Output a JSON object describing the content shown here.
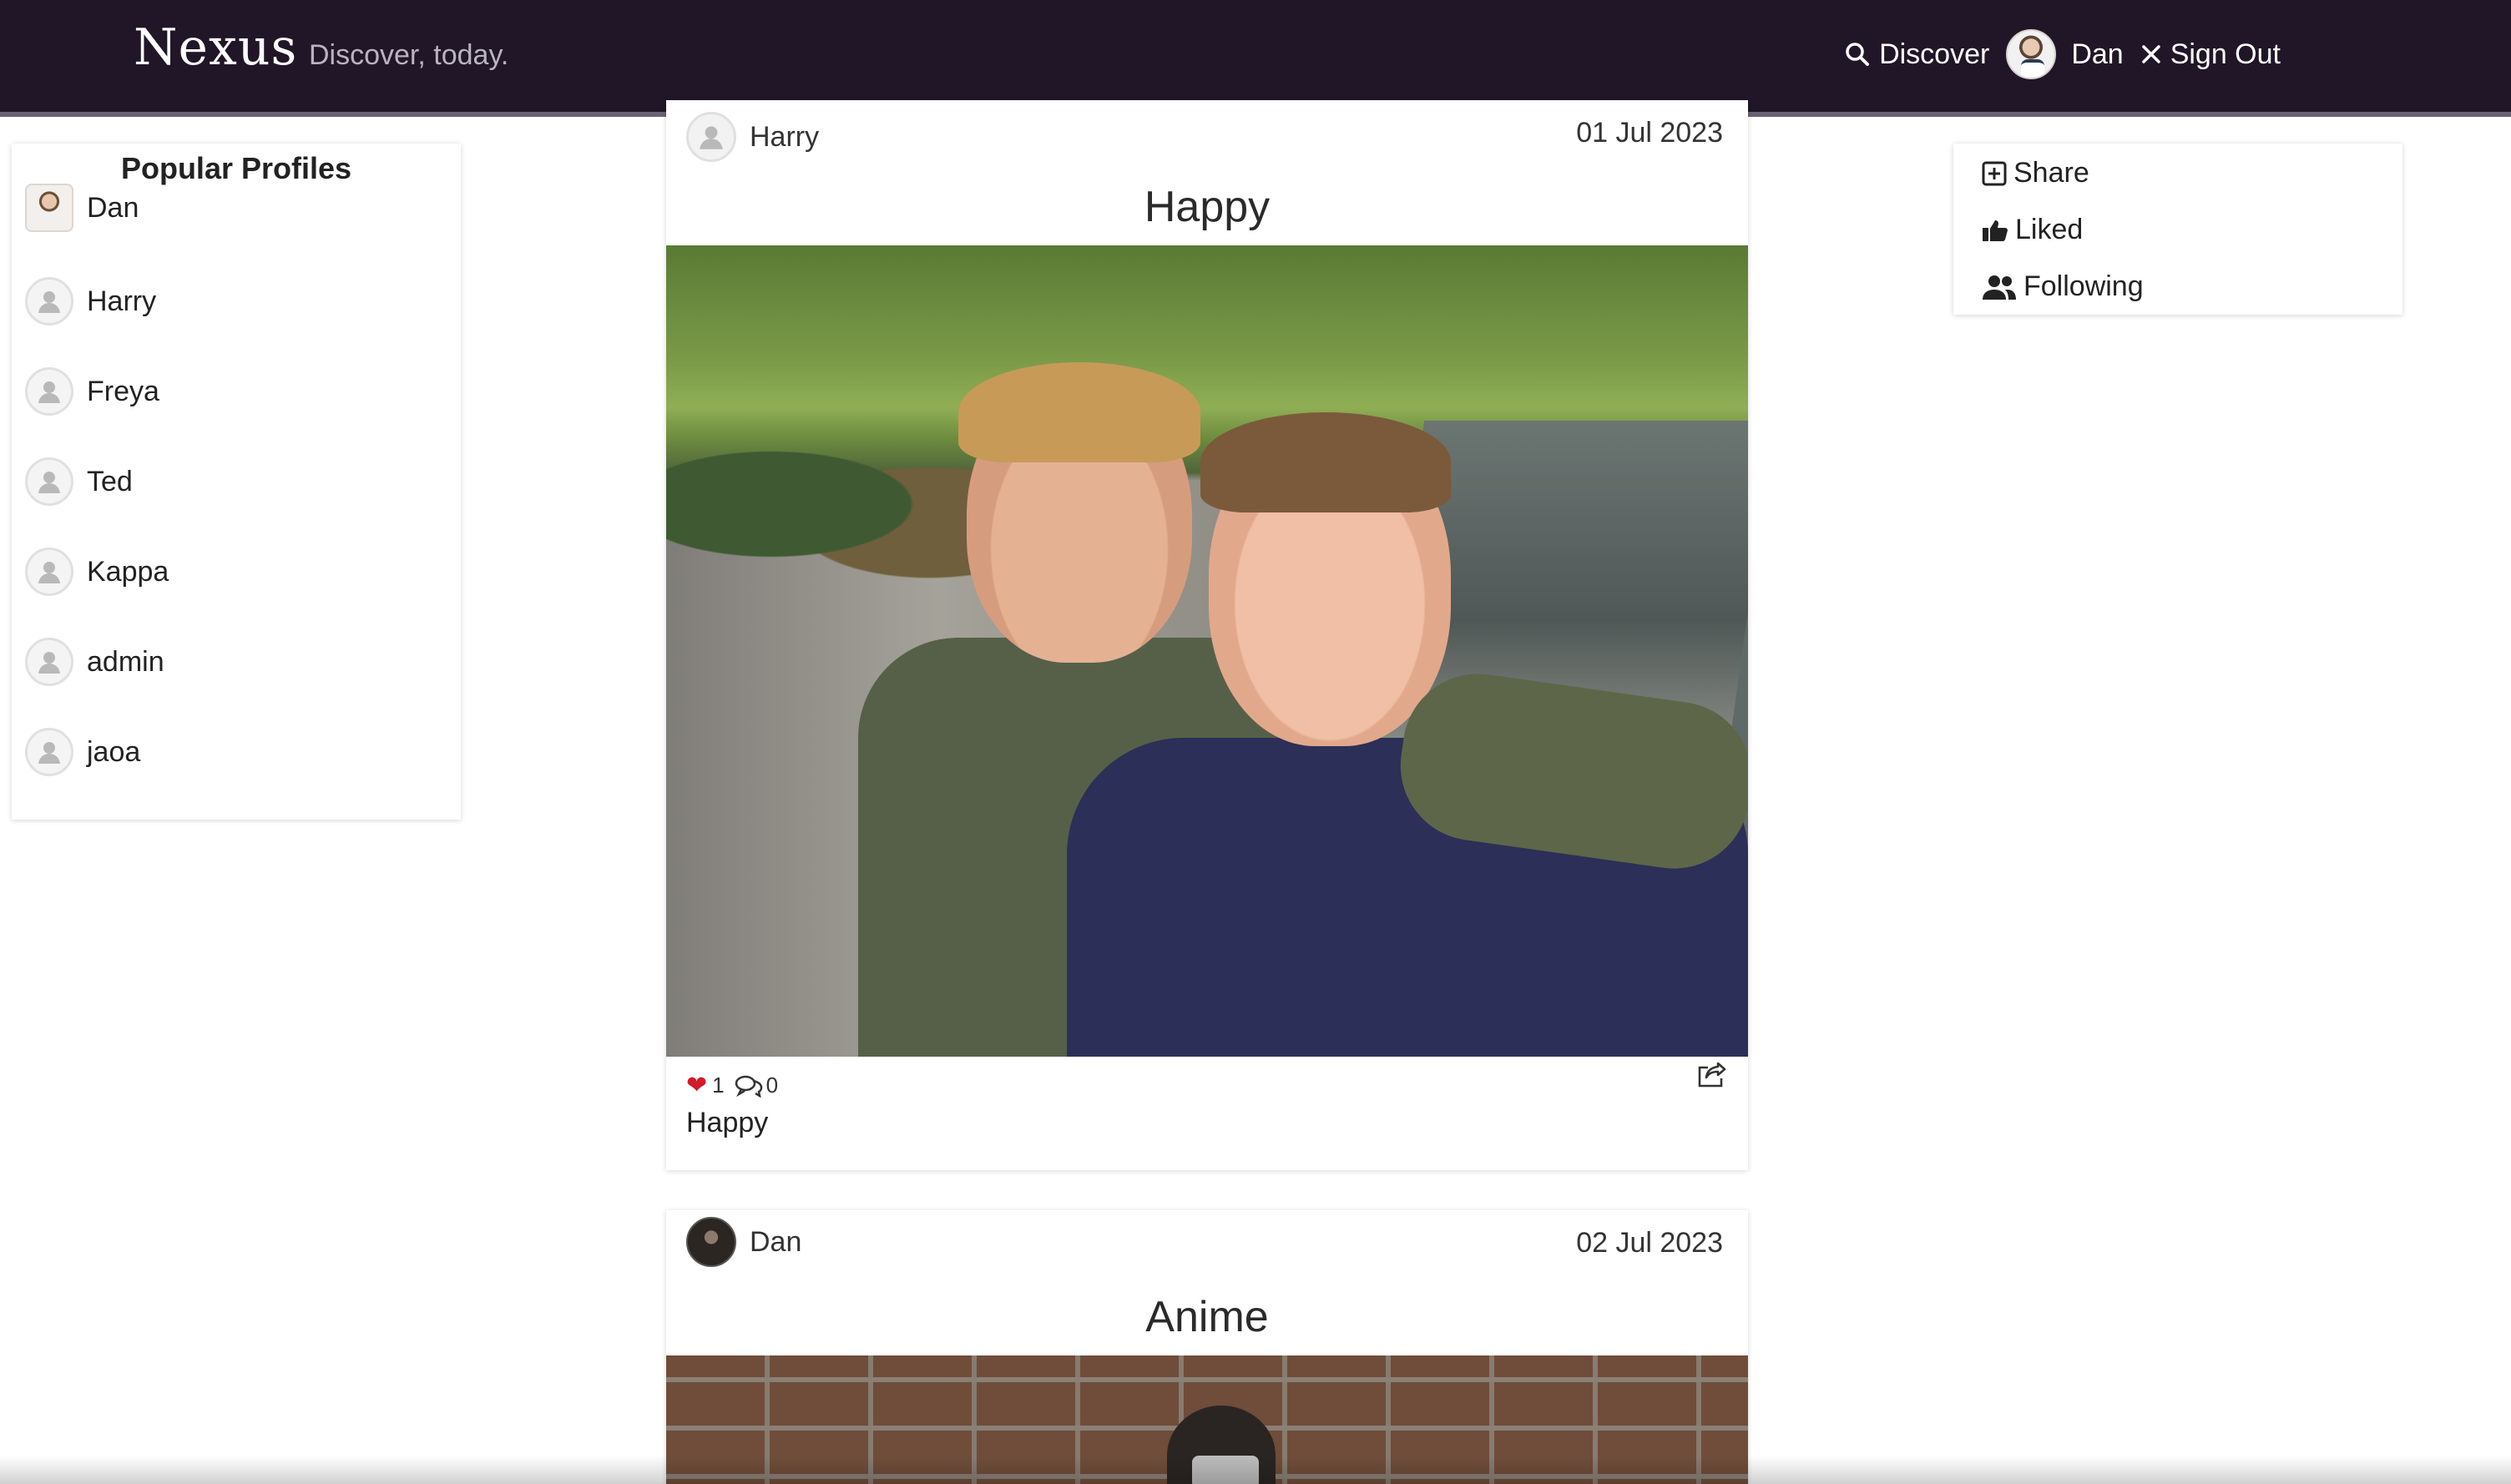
{
  "navbar": {
    "brand": "Nexus",
    "tagline": "Discover, today.",
    "discover_label": "Discover",
    "user_name": "Dan",
    "signout_label": "Sign Out"
  },
  "popular": {
    "title": "Popular Profiles",
    "profiles": [
      {
        "name": "Dan"
      },
      {
        "name": "Harry"
      },
      {
        "name": "Freya"
      },
      {
        "name": "Ted"
      },
      {
        "name": "Kappa"
      },
      {
        "name": "admin"
      },
      {
        "name": "jaoa"
      }
    ]
  },
  "posts": [
    {
      "author": "Harry",
      "date": "01 Jul 2023",
      "title": "Happy",
      "likes": "1",
      "comments": "0",
      "caption": "Happy"
    },
    {
      "author": "Dan",
      "date": "02 Jul 2023",
      "title": "Anime"
    }
  ],
  "sidebar_menu": {
    "share_label": "Share",
    "liked_label": "Liked",
    "following_label": "Following"
  },
  "colors": {
    "navbar_bg": "#211627",
    "like_red": "#d11a2a"
  },
  "icons": {
    "discover": "search-icon",
    "signout": "close-icon",
    "share": "plus-square-icon",
    "liked": "thumbs-up-icon",
    "following": "users-icon",
    "like": "heart-icon",
    "comments": "comments-icon",
    "post_share": "share-icon",
    "default_avatar": "user-icon"
  }
}
